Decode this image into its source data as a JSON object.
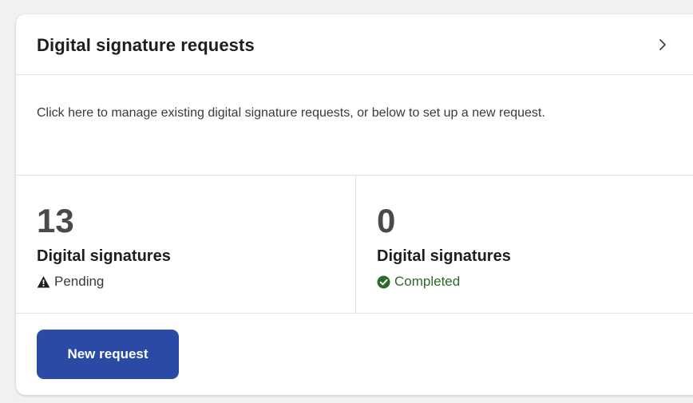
{
  "card": {
    "title": "Digital signature requests",
    "chevron_icon": "chevron-right-icon",
    "description": "Click here to manage existing digital signature requests, or below to set up a new request."
  },
  "stats": [
    {
      "count": "13",
      "label": "Digital signatures",
      "status": "Pending",
      "status_icon": "warning-triangle-icon",
      "status_color": "#1e1e1e"
    },
    {
      "count": "0",
      "label": "Digital signatures",
      "status": "Completed",
      "status_icon": "check-circle-icon",
      "status_color": "#2b6a2b"
    }
  ],
  "actions": {
    "new_request_label": "New request",
    "button_color": "#2a4aa6"
  }
}
